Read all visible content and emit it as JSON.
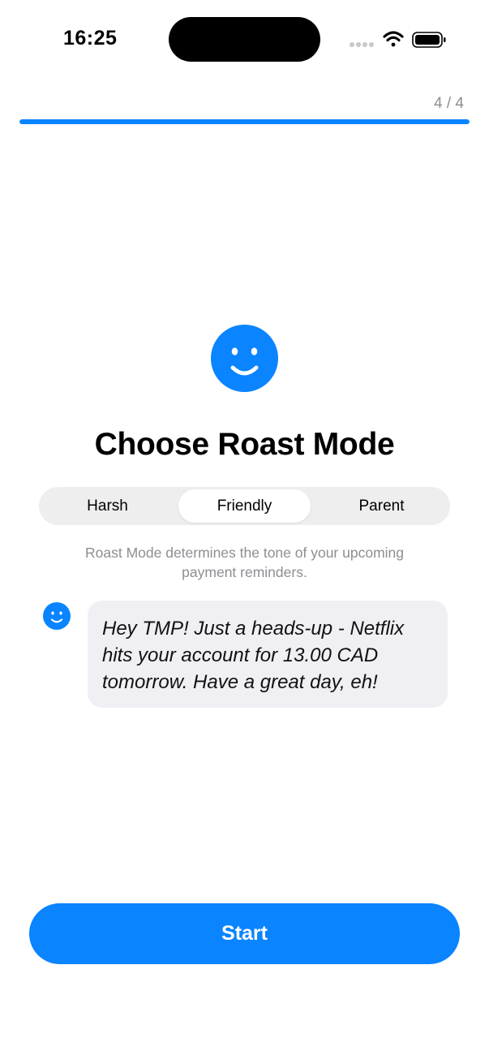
{
  "status_bar": {
    "time": "16:25",
    "icons": [
      "cellular-dots-icon",
      "wifi-icon",
      "battery-icon"
    ]
  },
  "progress": {
    "label": "4 / 4",
    "current": 4,
    "total": 4,
    "fraction": 1.0
  },
  "hero": {
    "icon": "smiley-face-icon",
    "title": "Choose Roast Mode"
  },
  "mode_selector": {
    "options": [
      "Harsh",
      "Friendly",
      "Parent"
    ],
    "selected": "Friendly"
  },
  "description": "Roast Mode determines the tone of your upcoming payment reminders.",
  "preview": {
    "avatar_icon": "smiley-face-icon",
    "message": "Hey TMP! Just a heads-up - Netflix hits your account for 13.00 CAD tomorrow. Have a great day, eh!"
  },
  "start_button": {
    "label": "Start"
  },
  "colors": {
    "accent": "#0a84ff",
    "secondary_text": "#8e8e93",
    "bubble_background": "#f0f0f4",
    "segmented_background": "#eeeeef"
  }
}
